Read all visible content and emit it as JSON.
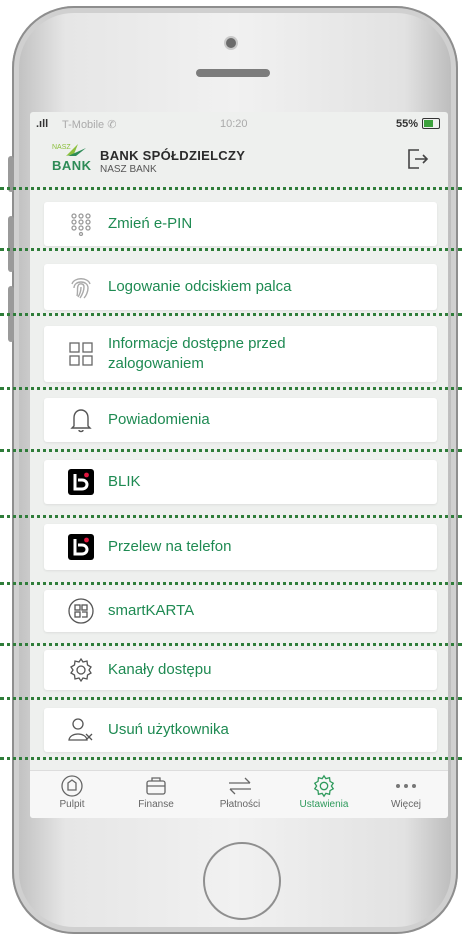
{
  "status": {
    "signal": ".ıll",
    "carrier": "T-Mobile  ✆",
    "time": "10:20",
    "battery": "55%"
  },
  "header": {
    "logo_small": "NASZ",
    "logo_big": "BANK",
    "bank_name": "BANK SPÓŁDZIELCZY",
    "bank_sub": "NASZ BANK"
  },
  "menu": {
    "items": [
      {
        "label": "Zmień e-PIN",
        "icon": "keypad-icon"
      },
      {
        "label": "Logowanie odciskiem palca",
        "icon": "fingerprint-icon"
      },
      {
        "label": "Informacje dostępne przed",
        "label2": "zalogowaniem",
        "icon": "grid-icon"
      },
      {
        "label": "Powiadomienia",
        "icon": "bell-icon"
      },
      {
        "label": "BLIK",
        "icon": "blik-icon"
      },
      {
        "label": "Przelew na telefon",
        "icon": "blik-icon"
      },
      {
        "label": "smartKARTA",
        "icon": "smartcard-icon"
      },
      {
        "label": "Kanały dostępu",
        "icon": "gear-icon"
      },
      {
        "label": "Usuń użytkownika",
        "icon": "remove-user-icon"
      }
    ]
  },
  "tabbar": {
    "tabs": [
      {
        "label": "Pulpit",
        "icon": "dashboard-icon"
      },
      {
        "label": "Finanse",
        "icon": "wallet-icon"
      },
      {
        "label": "Płatności",
        "icon": "transfer-arrows-icon"
      },
      {
        "label": "Ustawienia",
        "icon": "settings-icon",
        "active": true
      },
      {
        "label": "Więcej",
        "icon": "more-icon"
      }
    ]
  },
  "colors": {
    "accent": "#1e8a52",
    "active_tab": "#2f9a5c",
    "dotted_line": "#2f7d3a",
    "blik": "#000000",
    "blik_dot": "#e1173f"
  }
}
